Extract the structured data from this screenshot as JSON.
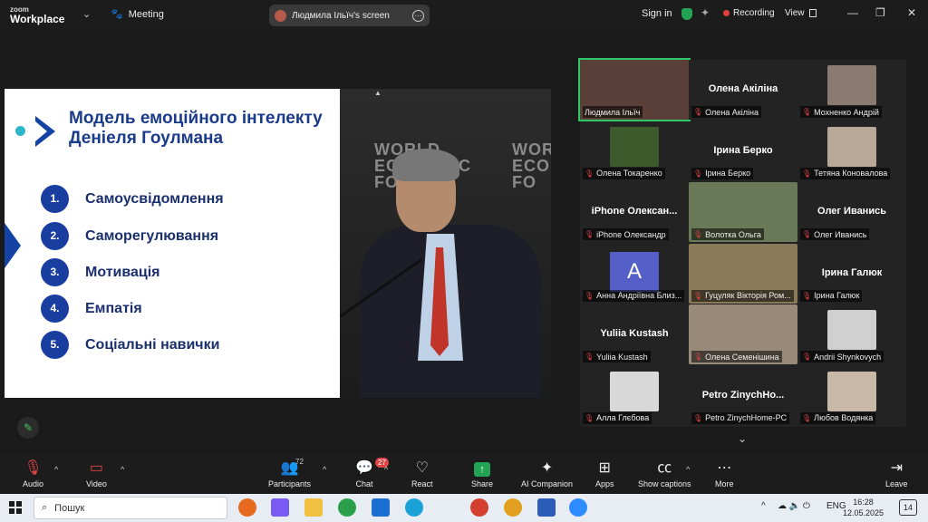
{
  "titlebar": {
    "logo_top": "zoom",
    "logo_bottom": "Workplace",
    "meeting_label": "Meeting",
    "share_label": "Людмила Ільїч's screen",
    "signin": "Sign in",
    "recording": "Recording",
    "view": "View"
  },
  "slide": {
    "title": "Модель емоційного інтелекту Деніеля Гоулмана",
    "items": [
      {
        "num": "1.",
        "text": "Самоусвідомлення"
      },
      {
        "num": "2.",
        "text": "Саморегулювання"
      },
      {
        "num": "3.",
        "text": "Мотивація"
      },
      {
        "num": "4.",
        "text": "Емпатія"
      },
      {
        "num": "5.",
        "text": "Соціальні навички"
      }
    ],
    "photo_text_1": "WORLD ECONOMIC FO",
    "photo_text_2": "WORLD ECONOMIC FO"
  },
  "gallery": {
    "tiles": [
      {
        "label": "Людмила Ільїч",
        "big": "",
        "active": true,
        "photo": "#5a4038",
        "muted": false
      },
      {
        "label": "Олена Акіліна",
        "big": "Олена Акіліна",
        "muted": true
      },
      {
        "label": "Мохненко Андрій",
        "big": "",
        "photo": "#8a7a70",
        "muted": true
      },
      {
        "label": "Олена Токаренко",
        "big": "",
        "photo": "#3d5a2c",
        "muted": true
      },
      {
        "label": "Ірина Берко",
        "big": "Ірина Берко",
        "muted": true
      },
      {
        "label": "Тетяна Коновалова",
        "big": "",
        "photo": "#b9a898",
        "muted": true
      },
      {
        "label": "iPhone Олександр",
        "big": "iPhone  Олексан...",
        "muted": true
      },
      {
        "label": "Волотка Ольга",
        "big": "",
        "photo": "#6a7a58",
        "muted": true
      },
      {
        "label": "Олег Иванись",
        "big": "Олег Иванись",
        "muted": true
      },
      {
        "label": "Анна Андріївна Близ...",
        "big": "",
        "avatar": "A",
        "muted": true
      },
      {
        "label": "Гуцуляк Вікторія Ром...",
        "big": "",
        "photo": "#8a7a5a",
        "muted": true
      },
      {
        "label": "Ірина Галюк",
        "big": "Ірина Галюк",
        "muted": true
      },
      {
        "label": "Yuliia Kustash",
        "big": "Yuliia Kustash",
        "muted": true
      },
      {
        "label": "Олена Семенішина",
        "big": "",
        "photo": "#9a8a7a",
        "muted": true
      },
      {
        "label": "Andrii Shynkovych",
        "big": "",
        "photo": "#d0d0d0",
        "muted": true
      },
      {
        "label": "Алла Глєбова",
        "big": "",
        "photo": "#d8d8d8",
        "muted": true
      },
      {
        "label": "Petro ZinychHome-PC",
        "big": "Petro  ZinychHo...",
        "muted": true
      },
      {
        "label": "Любов Водянка",
        "big": "",
        "photo": "#c8b8a8",
        "muted": true
      }
    ]
  },
  "toolbar": {
    "audio": "Audio",
    "video": "Video",
    "participants": "Participants",
    "participants_count": "72",
    "chat": "Chat",
    "chat_badge": "27",
    "react": "React",
    "share": "Share",
    "ai": "AI Companion",
    "apps": "Apps",
    "captions": "Show captions",
    "more": "More",
    "leave": "Leave"
  },
  "taskbar": {
    "search_placeholder": "Пошук",
    "lang": "ENG",
    "time": "16:28",
    "date": "12.05.2025",
    "notifications": "14"
  }
}
